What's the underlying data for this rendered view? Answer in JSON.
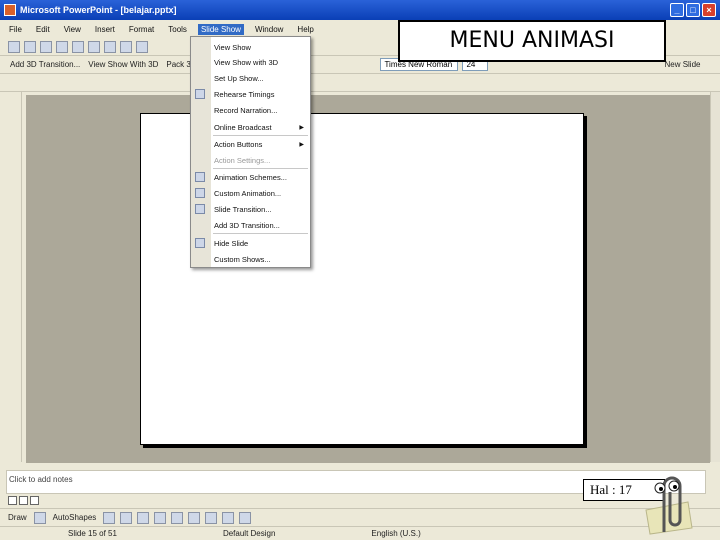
{
  "window": {
    "title": "Microsoft PowerPoint - [belajar.pptx]"
  },
  "menubar": [
    "File",
    "Edit",
    "View",
    "Insert",
    "Format",
    "Tools",
    "Slide Show",
    "Window",
    "Help"
  ],
  "toolbar2": {
    "btn1": "Add 3D Transition...",
    "btn2": "View Show With 3D",
    "btn3": "Pack 3D Eff",
    "font": "Times New Roman",
    "size": "24",
    "newslide": "New Slide"
  },
  "menu": {
    "items": [
      {
        "label": "View Show"
      },
      {
        "label": "View Show with 3D"
      },
      {
        "label": "Set Up Show..."
      },
      {
        "label": "Rehearse Timings"
      },
      {
        "label": "Record Narration..."
      },
      {
        "label": "Online Broadcast"
      },
      {
        "label": "Action Buttons"
      },
      {
        "label": "Action Settings..."
      },
      {
        "label": "Animation Schemes..."
      },
      {
        "label": "Custom Animation..."
      },
      {
        "label": "Slide Transition..."
      },
      {
        "label": "Add 3D Transition..."
      },
      {
        "label": "Hide Slide"
      },
      {
        "label": "Custom Shows..."
      }
    ]
  },
  "notes": {
    "placeholder": "Click to add notes"
  },
  "drawbar": {
    "draw": "Draw",
    "autoshapes": "AutoShapes"
  },
  "status": {
    "slide": "Slide 15 of 51",
    "design": "Default Design",
    "lang": "English (U.S.)"
  },
  "callout": "MENU ANIMASI",
  "page": "Hal : 17",
  "colors": {
    "title_bar": "#0a3fb6",
    "menu_highlight": "#316ac5",
    "workspace": "#aca899"
  }
}
